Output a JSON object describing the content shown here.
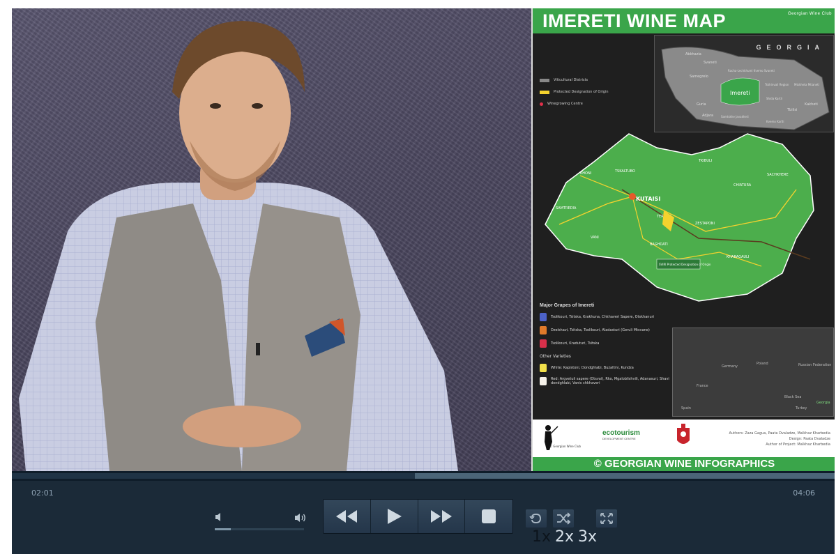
{
  "video": {
    "map_title": "IMERETI WINE MAP",
    "map_club": "Georgian Wine Club",
    "map_country": "GEORGIA",
    "map_inset_region": "Imereti",
    "map_inset_places": [
      "Abkhazia",
      "Svaneti",
      "Samegrelo",
      "Racha-Lechkhumi Kvemo Svaneti",
      "Tskhinvali Region",
      "Mtskheta Mtianeti",
      "Guria",
      "Adjara",
      "Shida Kartli",
      "Samtskhe Javakheti",
      "Kvemo Kartli",
      "Tbilisi",
      "Kakheti"
    ],
    "map_legend": [
      "Viticultural Districts",
      "Protected Designation of Origin",
      "Winegrowing Centre"
    ],
    "map_places": [
      "KUTAISI",
      "TSKALTUBO",
      "KHONI",
      "TKIBULI",
      "SACHKHERE",
      "ZESTAPONI",
      "BAGHDATI",
      "VANI",
      "SAMTREDIA",
      "TERJOLA",
      "KHARAGAULI",
      "CHIATURA"
    ],
    "map_pdo_label": "SVIRI Protected Designation of Origin",
    "map_grapes_title": "Major Grapes of Imereti",
    "map_grapes": [
      "Tsolikouri, Tsitska, Krakhuna, Chkhaveri Sapere, Otskhanuri",
      "Dzelshavi, Tsitska, Tsolikouri, Aladasturi (Geruli Mtsvane)",
      "Tsolikouri, Kraduturi, Tsitska"
    ],
    "map_other_varieties": "Other Varieties",
    "map_other_white": "White: Kapistoni, Dondghlabi, Buzaltini, Kundza",
    "map_other_red": "Red: Argvetuli sapere (Otsvai), Rko, Mgaloblishvili, Adanasuri, Shavi dondghlabi, Vanis chkhaveri",
    "map_europe": [
      "Germany",
      "Poland",
      "France",
      "Spain",
      "Black Sea",
      "Turkey",
      "Russian Federation",
      "Georgia"
    ],
    "map_sponsor": "ecotourism",
    "map_sponsor_sub": "DEVELOPMENT CENTRE",
    "map_authors": [
      "Authors: Zaza Gagua, Paata Dvaladze, Malkhaz Kharbedia",
      "Design: Paata Dvaladze",
      "Author of Project: Malkhaz Kharbedia"
    ],
    "map_copyright": "© Georgian Wine Club",
    "map_footer": "© GEORGIAN WINE INFOGRAPHICS"
  },
  "controls": {
    "current_time": "02:01",
    "total_time": "04:06",
    "progress_fraction": 0.49,
    "volume_fraction": 0.18,
    "speed_options": [
      "1x",
      "2x",
      "3x"
    ],
    "speed_selected": "1x"
  },
  "icons": {
    "volume_mute": "speaker-low-icon",
    "volume_loud": "speaker-high-icon",
    "rewind": "rewind-icon",
    "play": "play-icon",
    "fast_forward": "fast-forward-icon",
    "stop": "stop-icon",
    "repeat": "repeat-icon",
    "shuffle": "shuffle-icon",
    "fullscreen": "fullscreen-icon"
  },
  "colors": {
    "map_green": "#3aa54a",
    "player_bg": "#1b2a38",
    "accent_text": "#d8e2ea"
  }
}
